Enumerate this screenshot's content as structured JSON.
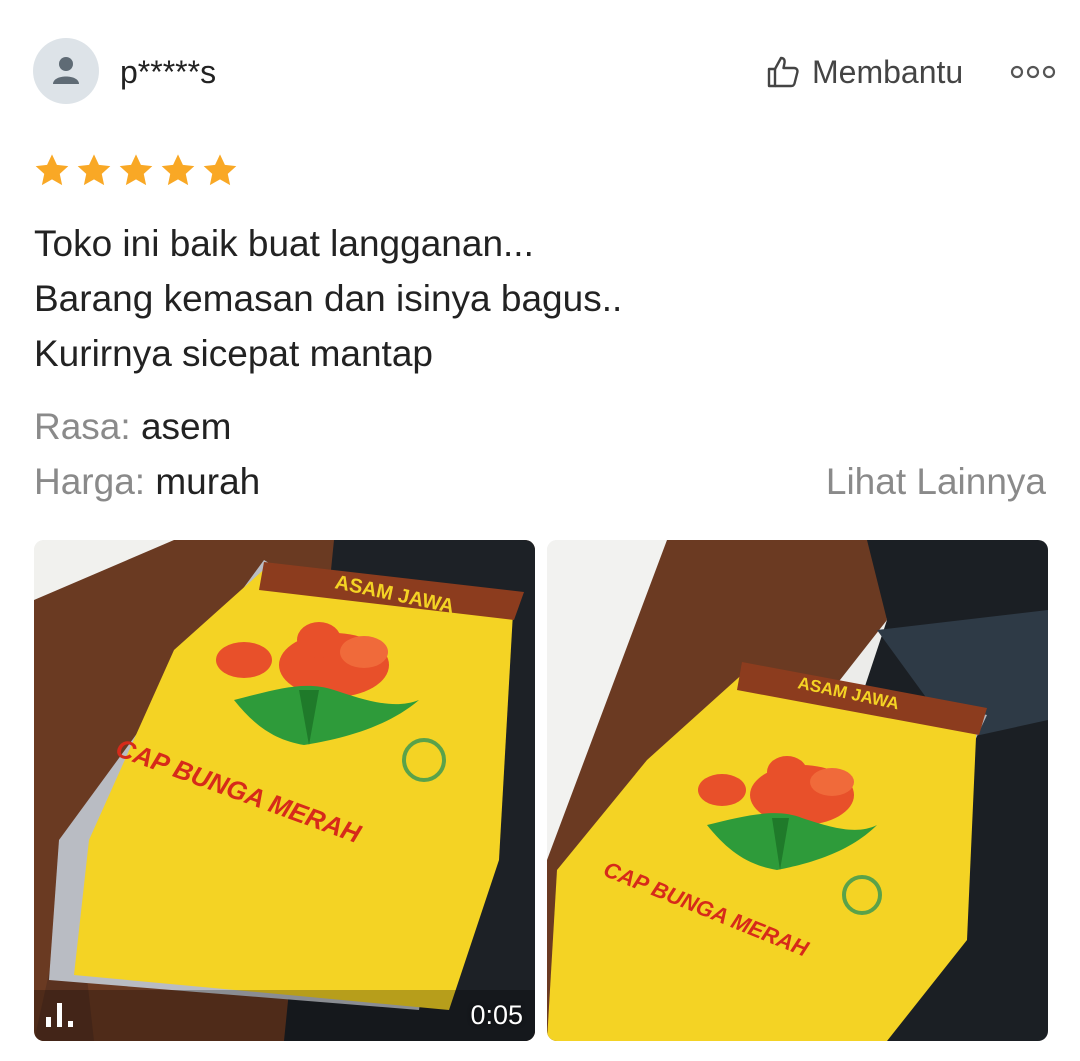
{
  "reviewer": {
    "name": "p*****s",
    "avatar_icon": "user-icon"
  },
  "actions": {
    "helpful_label": "Membantu",
    "helpful_icon": "thumbs-up-icon",
    "more_icon": "more-dots-icon"
  },
  "rating": {
    "stars": 5,
    "max": 5,
    "color": "#f9a825"
  },
  "review": {
    "lines": [
      "Toko ini baik buat langganan...",
      "Barang kemasan dan isinya bagus..",
      "Kurirnya sicepat mantap"
    ]
  },
  "attributes": [
    {
      "label": "Rasa:",
      "value": "asem"
    },
    {
      "label": "Harga:",
      "value": "murah"
    }
  ],
  "see_more_label": "Lihat Lainnya",
  "media": [
    {
      "type": "video",
      "duration": "0:05",
      "icon": "video-bars-icon",
      "package_text": "CAP BUNGA MERAH",
      "brand_text": "ASAM JAWA"
    },
    {
      "type": "photo",
      "package_text": "CAP BUNGA MERAH",
      "brand_text": "ASAM JAWA"
    }
  ],
  "colors": {
    "secondary_text": "#8a8a8a",
    "package_yellow": "#f4d324",
    "flower_red": "#e8502a"
  }
}
